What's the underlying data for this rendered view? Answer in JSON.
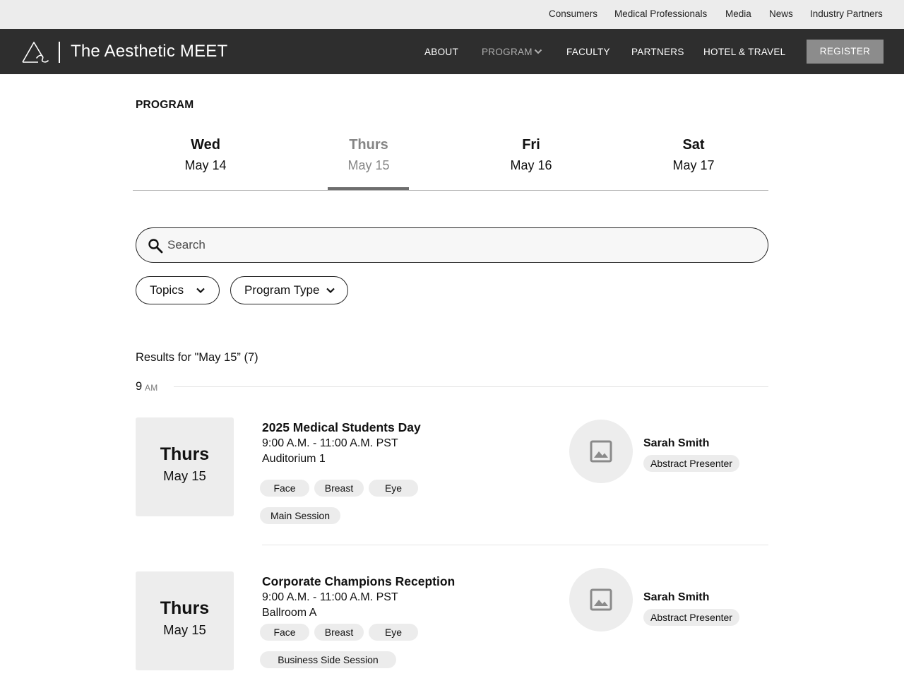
{
  "utility_nav": {
    "links": [
      "Consumers",
      "Medical Professionals",
      "Media",
      "News",
      "Industry Partners"
    ]
  },
  "main_nav": {
    "brand": "The Aesthetic MEET",
    "links": [
      "ABOUT",
      "PROGRAM",
      "FACULTY",
      "PARTNERS",
      "HOTEL & TRAVEL"
    ],
    "active": "PROGRAM",
    "register_label": "REGISTER"
  },
  "program": {
    "section_title": "PROGRAM",
    "days": [
      {
        "dow": "Wed",
        "date": "May 14"
      },
      {
        "dow": "Thurs",
        "date": "May 15"
      },
      {
        "dow": "Fri",
        "date": "May 16"
      },
      {
        "dow": "Sat",
        "date": "May 17"
      }
    ],
    "active_day": "Thurs",
    "search": {
      "placeholder": "Search",
      "value": ""
    },
    "filters": [
      "Topics",
      "Program Type"
    ],
    "results_label": "Results for \"May 15” (7)",
    "time_group": {
      "hour": "9",
      "ampm": "AM"
    },
    "events": [
      {
        "tile_dow": "Thurs",
        "tile_date": "May 15",
        "title": "2025 Medical Students Day",
        "time": "9:00 A.M. - 11:00 A.M. PST",
        "room": "Auditorium 1",
        "topic_tags": [
          "Face",
          "Breast",
          "Eye"
        ],
        "type_tag": "Main Session",
        "presenter_name": "Sarah Smith",
        "presenter_role": "Abstract Presenter"
      },
      {
        "tile_dow": "Thurs",
        "tile_date": "May 15",
        "title": "Corporate Champions Reception",
        "time": "9:00 A.M. - 11:00 A.M. PST",
        "room": "Ballroom A",
        "topic_tags": [
          "Face",
          "Breast",
          "Eye"
        ],
        "type_tag": "Business Side Session",
        "presenter_name": "Sarah Smith",
        "presenter_role": "Abstract Presenter"
      }
    ]
  },
  "colors": {
    "utility_bar_bg": "#ececec",
    "nav_bg": "#2e2e2e",
    "register_bg": "#8c8c8c",
    "active_tab": "#858585",
    "tag_bg": "#ececec"
  },
  "icons": [
    "logo-mark",
    "chevron-down-icon",
    "search-icon",
    "image-placeholder-icon"
  ]
}
